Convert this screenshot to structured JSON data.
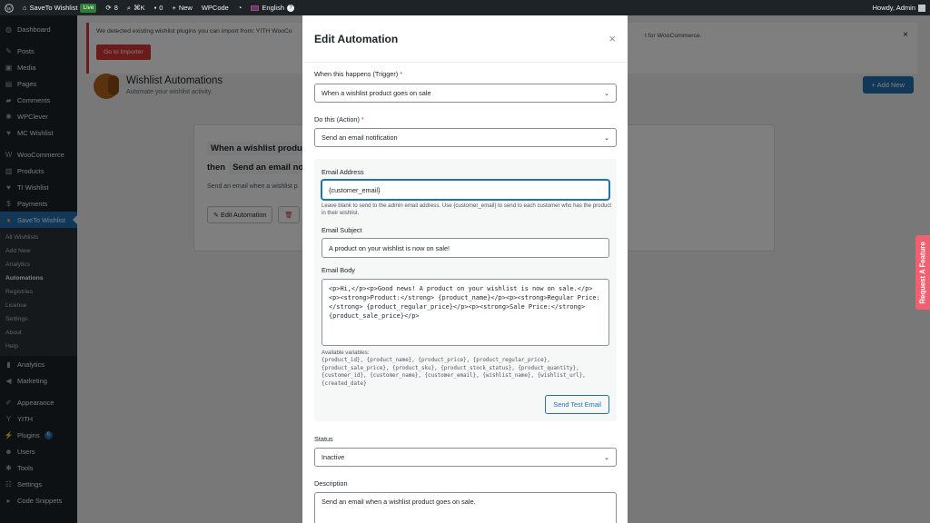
{
  "admin_bar": {
    "site_name": "SaveTo Wishlist",
    "live_badge": "Live",
    "updates_count": "8",
    "shortcut": "⌘K",
    "comments_count": "0",
    "new_label": "New",
    "wpcode_label": "WPCode",
    "language": "English",
    "greeting": "Howdy, Admin"
  },
  "sidebar": {
    "items_top": [
      {
        "label": "Dashboard",
        "icon": "dashboard-icon"
      },
      {
        "label": "Posts",
        "icon": "pin-icon"
      },
      {
        "label": "Media",
        "icon": "media-icon"
      },
      {
        "label": "Pages",
        "icon": "page-icon"
      },
      {
        "label": "Comments",
        "icon": "comment-icon"
      },
      {
        "label": "WPClever",
        "icon": "clever-icon"
      },
      {
        "label": "MC Wishlist",
        "icon": "heart-icon"
      },
      {
        "label": "WooCommerce",
        "icon": "woo-icon"
      },
      {
        "label": "Products",
        "icon": "products-icon"
      },
      {
        "label": "TI Wishlist",
        "icon": "ti-icon"
      },
      {
        "label": "Payments",
        "icon": "payments-icon"
      }
    ],
    "current": {
      "label": "SaveTo Wishlist",
      "icon": "squirrel-icon"
    },
    "submenu": [
      "All Wishlists",
      "Add New",
      "Analytics",
      "Automations",
      "Registries",
      "License",
      "Settings",
      "About",
      "Help"
    ],
    "submenu_active": "Automations",
    "items_bottom": [
      {
        "label": "Analytics",
        "icon": "analytics-icon"
      },
      {
        "label": "Marketing",
        "icon": "megaphone-icon"
      },
      {
        "label": "Appearance",
        "icon": "brush-icon"
      },
      {
        "label": "YITH",
        "icon": "yith-icon"
      },
      {
        "label": "Plugins",
        "icon": "plugin-icon",
        "badge": "6"
      },
      {
        "label": "Users",
        "icon": "users-icon"
      },
      {
        "label": "Tools",
        "icon": "wrench-icon"
      },
      {
        "label": "Settings",
        "icon": "settings-icon"
      },
      {
        "label": "Code Snippets",
        "icon": "code-icon"
      }
    ]
  },
  "notice": {
    "text": "We detected existing wishlist plugins you can import from: YITH WooCo",
    "tail": "t for WooCommerce.",
    "button": "Go to Importer",
    "dismiss": "×"
  },
  "page": {
    "title": "Wishlist Automations",
    "subtitle": "Automate your wishlist activity.",
    "add_new": "+ Add New"
  },
  "bg_card": {
    "when_prefix": "When a wishlist produc",
    "then_label": "then",
    "then_value": "Send an email notif",
    "desc": "Send an email when a wishlist p",
    "edit_button": "Edit Automation"
  },
  "modal": {
    "title": "Edit Automation",
    "close": "×",
    "trigger_label": "When this happens (Trigger)",
    "trigger_value": "When a wishlist product goes on sale",
    "action_label": "Do this (Action)",
    "action_value": "Send an email notification",
    "required_mark": "*",
    "email_address_label": "Email Address",
    "email_address_value": "{customer_email}",
    "email_address_help": "Leave blank to send to the admin email address. Use {customer_email} to send to each customer who has the product in their wishlist.",
    "email_subject_label": "Email Subject",
    "email_subject_value": "A product on your wishlist is now on sale!",
    "email_body_label": "Email Body",
    "email_body_value": "<p>Hi,</p><p>Good news! A product on your wishlist is now on sale.</p><p><strong>Product:</strong> {product_name}</p><p><strong>Regular Price:</strong> {product_regular_price}</p><p><strong>Sale Price:</strong> {product_sale_price}</p>",
    "vars_label": "Available variables:",
    "vars": "{product_id}, {product_name}, {product_price}, {product_regular_price}, {product_sale_price}, {product_sku}, {product_stock_status}, {product_quantity}, {customer_id}, {customer_name}, {customer_email}, {wishlist_name}, {wishlist_url}, {created_date}",
    "test_button": "Send Test Email",
    "status_label": "Status",
    "status_value": "Inactive",
    "description_label": "Description",
    "description_value": "Send an email when a wishlist product goes on sale."
  },
  "feature_tab": "Request A Feature"
}
